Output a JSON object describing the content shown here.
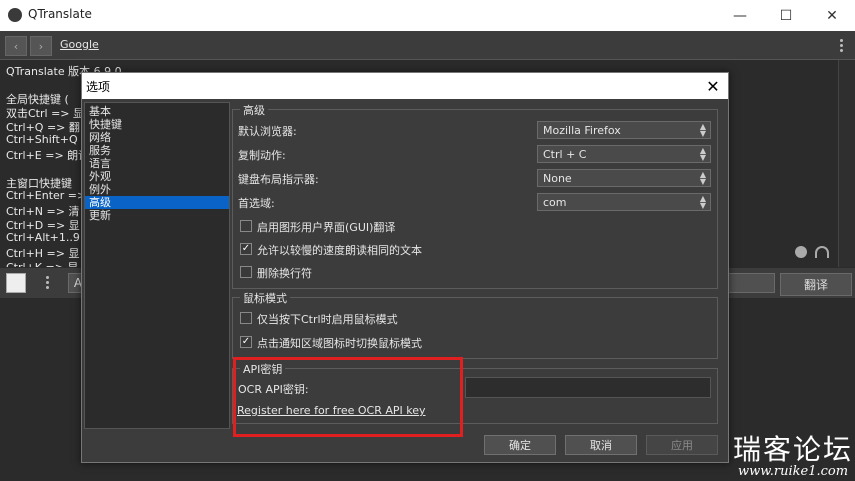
{
  "window": {
    "title": "QTranslate",
    "minimize": "—",
    "maximize": "☐",
    "close": "✕"
  },
  "toolbar": {
    "back": "‹",
    "forward": "›",
    "service": "Google"
  },
  "text_area": {
    "lines": [
      "QTranslate 版本 6.9.0",
      "",
      "全局快捷键 (",
      "双击Ctrl => 显",
      "Ctrl+Q => 翻",
      "Ctrl+Shift+Q",
      "Ctrl+E => 朗读",
      "",
      "主窗口快捷键",
      "Ctrl+Enter =>",
      "Ctrl+N => 清",
      "Ctrl+D => 显",
      "Ctrl+Alt+1..9",
      "Ctrl+H => 显",
      "Ctrl+K => 显"
    ]
  },
  "midbar": {
    "lang_stub": "A",
    "translate": "翻译"
  },
  "dialog": {
    "title": "选项",
    "close": "✕",
    "categories": [
      "基本",
      "快捷键",
      "网络",
      "服务",
      "语言",
      "外观",
      "例外",
      "高级",
      "更新"
    ],
    "selected_category": "高级",
    "advanced": {
      "title": "高级",
      "browser_label": "默认浏览器:",
      "browser_value": "Mozilla Firefox",
      "copy_label": "复制动作:",
      "copy_value": "Ctrl + C",
      "keyboard_label": "键盘布局指示器:",
      "keyboard_value": "None",
      "domain_label": "首选域:",
      "domain_value": "com",
      "opt_gui": "启用图形用户界面(GUI)翻译",
      "opt_gui_checked": false,
      "opt_slow": "允许以较慢的速度朗读相同的文本",
      "opt_slow_checked": true,
      "opt_remove_lf": "删除换行符",
      "opt_remove_lf_checked": false
    },
    "mouse": {
      "title": "鼠标模式",
      "opt_ctrl": "仅当按下Ctrl时启用鼠标模式",
      "opt_ctrl_checked": false,
      "opt_tray": "点击通知区域图标时切换鼠标模式",
      "opt_tray_checked": true
    },
    "api": {
      "title": "API密钥",
      "ocr_label": "OCR API密钥:",
      "ocr_value": "",
      "register_link": "Register here for free OCR API key"
    },
    "buttons": {
      "ok": "确定",
      "cancel": "取消",
      "apply": "应用"
    }
  },
  "watermark": {
    "line1": "瑞客论坛",
    "line2": "www.ruike1.com"
  },
  "colors": {
    "selection": "#0a64c8",
    "highlight_box": "#e02020"
  }
}
